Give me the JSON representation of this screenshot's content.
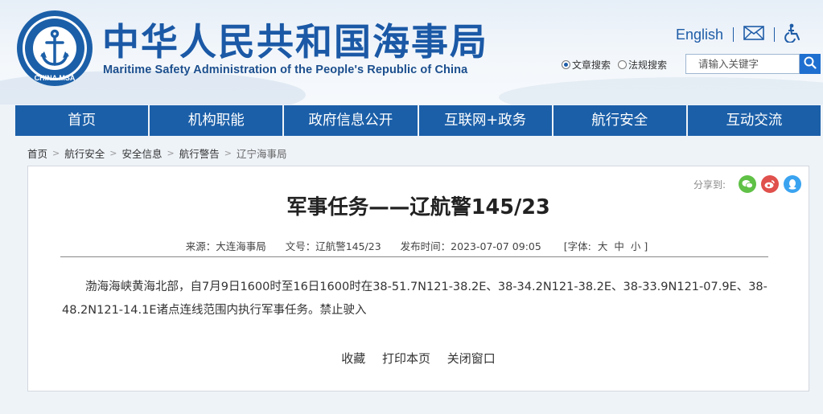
{
  "header": {
    "logo_text": "CHINA MSA",
    "title": "中华人民共和国海事局",
    "subtitle": "Maritime Safety Administration of the People's Republic of China",
    "english_link": "English"
  },
  "search": {
    "option_article": "文章搜索",
    "option_law": "法规搜索",
    "placeholder": "请输入关键字",
    "selected": "文章搜索"
  },
  "nav": {
    "items": [
      "首页",
      "机构职能",
      "政府信息公开",
      "互联网+政务",
      "航行安全",
      "互动交流"
    ]
  },
  "breadcrumb": {
    "items": [
      "首页",
      "航行安全",
      "安全信息",
      "航行警告",
      "辽宁海事局"
    ]
  },
  "share": {
    "label": "分享到:",
    "icons": [
      "wechat-icon",
      "weibo-icon",
      "qq-icon"
    ]
  },
  "article": {
    "title": "军事任务——辽航警145/23",
    "source": "来源：大连海事局",
    "doc_no": "文号：辽航警145/23",
    "publish_time": "发布时间：2023-07-07 09:05",
    "font_label": "[字体:",
    "font_large": "大",
    "font_medium": "中",
    "font_small": "小 ]",
    "body": "渤海海峡黄海北部，自7月9日1600时至16日1600时在38-51.7N121-38.2E、38-34.2N121-38.2E、38-33.9N121-07.9E、38-48.2N121-14.1E诸点连线范围内执行军事任务。禁止驶入"
  },
  "actions": {
    "favorite": "收藏",
    "print": "打印本页",
    "close": "关闭窗口"
  },
  "colors": {
    "brand_blue": "#1b5fa8",
    "title_blue": "#1b59a6",
    "wechat_green": "#5fc146",
    "weibo_red": "#e0504c",
    "qq_blue": "#3aa3f0"
  }
}
